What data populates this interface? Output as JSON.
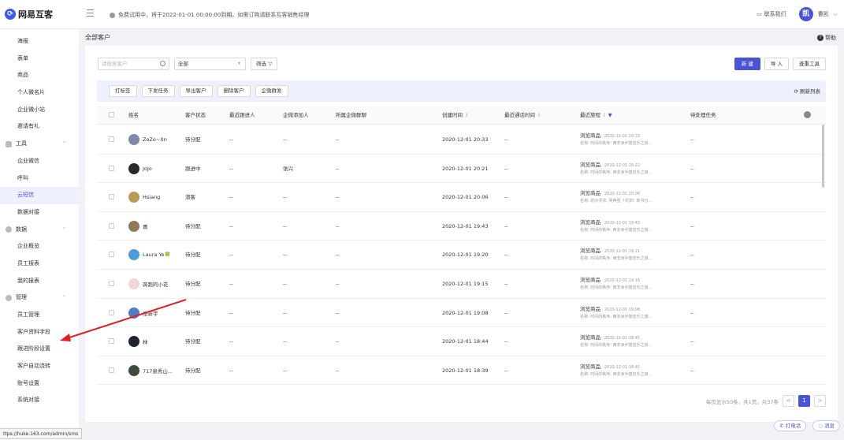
{
  "topbar": {
    "logo": "网易互客",
    "notice": "免费试用中，将于2022-01-01 00:00:00到期。如需订购请联系互客销售经理",
    "contact": "联系我们",
    "avatar_text": "凯",
    "user": "曹凯"
  },
  "sidebar": {
    "items": [
      {
        "label": "海报",
        "type": "item"
      },
      {
        "label": "表单",
        "type": "item"
      },
      {
        "label": "商品",
        "type": "item"
      },
      {
        "label": "个人微名片",
        "type": "item"
      },
      {
        "label": "企业微小站",
        "type": "item"
      },
      {
        "label": "邀请有礼",
        "type": "item"
      },
      {
        "label": "工具",
        "type": "group",
        "icon": "grid-icon"
      },
      {
        "label": "企业微信",
        "type": "item"
      },
      {
        "label": "呼叫",
        "type": "item"
      },
      {
        "label": "云短信",
        "type": "item",
        "active": true
      },
      {
        "label": "数据对接",
        "type": "item"
      },
      {
        "label": "数据",
        "type": "group",
        "icon": "chart-icon"
      },
      {
        "label": "企业概览",
        "type": "item"
      },
      {
        "label": "员工报表",
        "type": "item"
      },
      {
        "label": "我的报表",
        "type": "item"
      },
      {
        "label": "管理",
        "type": "group",
        "icon": "settings-icon"
      },
      {
        "label": "员工管理",
        "type": "item"
      },
      {
        "label": "客户资料字段",
        "type": "item"
      },
      {
        "label": "跟进阶段设置",
        "type": "item"
      },
      {
        "label": "客户自动流转",
        "type": "item"
      },
      {
        "label": "账号设置",
        "type": "item"
      },
      {
        "label": "系统对接",
        "type": "item"
      }
    ]
  },
  "status_url": "ttps://huke.163.com/admin/sms",
  "main": {
    "breadcrumb": "全部客户",
    "help": "帮助",
    "search_placeholder": "请搜索客户",
    "select_value": "全部",
    "filter_label": "筛选",
    "btn_new": "新 建",
    "btn_import": "导 入",
    "btn_dedupe": "查重工具",
    "actions": [
      "打标签",
      "下发任务",
      "导出客户",
      "删除客户",
      "企微群发"
    ],
    "refresh": "刷新列表",
    "columns": [
      "姓名",
      "客户状态",
      "最近跟进人",
      "企微添加人",
      "所属企微群聊",
      "创建时间",
      "最近通话时间",
      "最近旅程",
      "待处理任务"
    ],
    "rows": [
      {
        "name": "ZoZo~Xn",
        "status": "待分配",
        "follower": "--",
        "adder": "--",
        "group": "--",
        "created": "2020-12-01 20:33",
        "last_call": "--",
        "journey": "浏览商品",
        "journey_time": "2020-12-01 20:33",
        "journey_detail": "名称: 时间的秩序: 西非洲手鼓音乐之旅...",
        "task": "--",
        "avatar_color": "#7a8aa8"
      },
      {
        "name": "JoJo",
        "status": "跟进中",
        "follower": "--",
        "adder": "张兴",
        "group": "--",
        "created": "2020-12-01 20:21",
        "last_call": "--",
        "journey": "浏览商品",
        "journey_time": "2020-12-01 20:22",
        "journey_detail": "名称: 时间的秩序: 西非洲手鼓音乐之旅...",
        "task": "--",
        "avatar_color": "#2a2a2a"
      },
      {
        "name": "Hsiang",
        "status": "潜客",
        "follower": "--",
        "adder": "--",
        "group": "--",
        "created": "2020-12-01 20:06",
        "last_call": "--",
        "journey": "浏览商品",
        "journey_time": "2020-12-01 20:06",
        "journey_detail": "名称: 杭州寻求: 吴神强《寻求》新书分...",
        "task": "--",
        "avatar_color": "#b79a56"
      },
      {
        "name": "菁",
        "status": "待分配",
        "follower": "--",
        "adder": "--",
        "group": "--",
        "created": "2020-12-01 19:43",
        "last_call": "--",
        "journey": "浏览商品",
        "journey_time": "2020-12-01 19:43",
        "journey_detail": "名称: 时间的秩序: 西非洲手鼓音乐之旅...",
        "task": "--",
        "avatar_color": "#8e7a5a"
      },
      {
        "name": "Laura Ye🍀",
        "status": "待分配",
        "follower": "--",
        "adder": "--",
        "group": "--",
        "created": "2020-12-01 19:20",
        "last_call": "--",
        "journey": "浏览商品",
        "journey_time": "2020-12-01 19:21",
        "journey_detail": "名称: 时间的秩序: 西非洲手鼓音乐之旅...",
        "task": "--",
        "avatar_color": "#4f9bd6"
      },
      {
        "name": "奔跑的小花",
        "status": "待分配",
        "follower": "--",
        "adder": "--",
        "group": "--",
        "created": "2020-12-01 19:15",
        "last_call": "--",
        "journey": "浏览商品",
        "journey_time": "2020-12-01 19:16",
        "journey_detail": "名称: 时间的秩序: 西非洲手鼓音乐之旅...",
        "task": "--",
        "avatar_color": "#f1d7d3"
      },
      {
        "name": "张新宇",
        "status": "待分配",
        "follower": "--",
        "adder": "--",
        "group": "--",
        "created": "2020-12-01 19:08",
        "last_call": "--",
        "journey": "浏览商品",
        "journey_time": "2020-12-01 19:08",
        "journey_detail": "名称: 时间的秩序: 西非洲手鼓音乐之旅...",
        "task": "--",
        "avatar_color": "#4f7fc2"
      },
      {
        "name": "林",
        "status": "待分配",
        "follower": "--",
        "adder": "--",
        "group": "--",
        "created": "2020-12-01 18:44",
        "last_call": "--",
        "journey": "浏览商品",
        "journey_time": "2020-12-01 18:45",
        "journey_detail": "名称: 时间的秩序: 西非洲手鼓音乐之旅...",
        "task": "--",
        "avatar_color": "#1e2433"
      },
      {
        "name": "717泉秀山...",
        "status": "待分配",
        "follower": "--",
        "adder": "--",
        "group": "--",
        "created": "2020-12-01 18:39",
        "last_call": "--",
        "journey": "浏览商品",
        "journey_time": "2020-12-01 18:45",
        "journey_detail": "名称: 时间的秩序: 西非洲手鼓音乐之旅...",
        "task": "--",
        "avatar_color": "#3e4a3a"
      }
    ],
    "pager_text": "每页显示50条，共1页，共37条",
    "page_prev": "<",
    "page_current": "1",
    "page_next": ">"
  },
  "footer": {
    "call": "打电话",
    "message": "消息"
  },
  "colors": {
    "accent": "#4a54d4",
    "annotation_arrow": "#e02020"
  }
}
